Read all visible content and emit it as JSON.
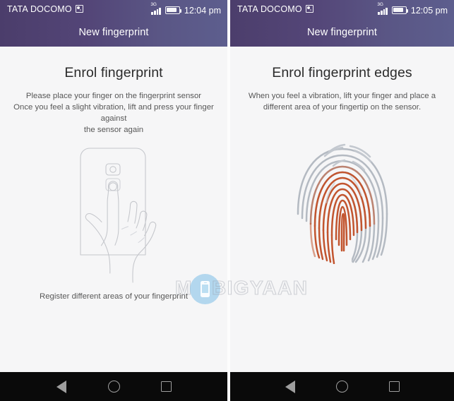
{
  "screens": [
    {
      "id": "screen-enrol-fingerprint",
      "status_bar": {
        "carrier": "TATA DOCOMO",
        "carrier_icon": "data-indicator-icon",
        "network_type": "3G",
        "signal_icon": "signal-bars-icon",
        "battery_icon": "battery-icon",
        "time": "12:04 pm"
      },
      "app_bar": {
        "title": "New fingerprint"
      },
      "content": {
        "headline": "Enrol fingerprint",
        "subtext_line1": "Please place your finger on the fingerprint sensor",
        "subtext_line2": "Once you feel a slight vibration, lift and press your finger against",
        "subtext_line3": "the sensor again",
        "illustration": "hand-pressing-phone-sensor-illustration",
        "caption": "Register different areas of your fingerprint"
      },
      "nav_bar": {
        "back_label": "Back",
        "home_label": "Home",
        "recents_label": "Recents"
      }
    },
    {
      "id": "screen-enrol-fingerprint-edges",
      "status_bar": {
        "carrier": "TATA DOCOMO",
        "carrier_icon": "data-indicator-icon",
        "network_type": "3G",
        "signal_icon": "signal-bars-icon",
        "battery_icon": "battery-icon",
        "time": "12:05 pm"
      },
      "app_bar": {
        "title": "New fingerprint"
      },
      "content": {
        "headline": "Enrol fingerprint edges",
        "subtext_line1": "When you feel a vibration, lift your finger and place a",
        "subtext_line2": "different area of your fingertip on the sensor.",
        "illustration": "fingerprint-ridges-illustration",
        "caption": ""
      },
      "nav_bar": {
        "back_label": "Back",
        "home_label": "Home",
        "recents_label": "Recents"
      }
    }
  ],
  "watermark": {
    "text_start": "M",
    "text_rest": "BIGYAAN",
    "badge_icon": "mobile-phone-icon"
  },
  "colors": {
    "status_bar_left": "#4b3d6b",
    "status_bar_right": "#5d5e8e",
    "page_background": "#f6f6f7",
    "headline_text": "#2b2b2b",
    "body_text": "#575757",
    "nav_bar": "#0a0a0a",
    "fingerprint_highlight": "#c2552f",
    "fingerprint_inactive": "#b6bcc4",
    "watermark_badge": "#89c4e8"
  }
}
